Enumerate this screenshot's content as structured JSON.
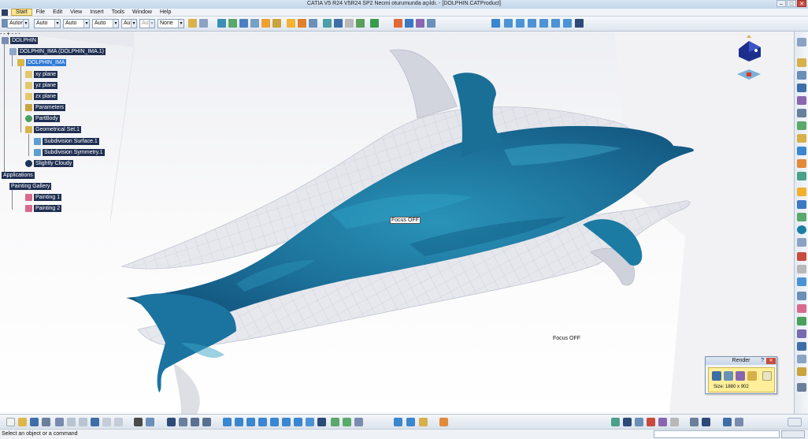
{
  "window": {
    "title": "CATIA V5 R24 V5R24 SP2 Necmi oturumunda açıldı. - [DOLPHIN.CATProduct]",
    "min_label": "–",
    "max_label": "□",
    "close_label": "✕"
  },
  "menu": {
    "items": [
      "Start",
      "File",
      "Edit",
      "View",
      "Insert",
      "Tools",
      "Window",
      "Help"
    ]
  },
  "toolbar": {
    "combos": [
      "Autom.",
      "Auto",
      "Auto",
      "Auto",
      "Aut",
      "Aut",
      "None"
    ]
  },
  "tree": {
    "root": "DOLPHIN",
    "instance": "DOLPHIN_IMA (DOLPHIN_IMA.1)",
    "part": "DOLPHIN_IMA",
    "xy_plane": "xy plane",
    "yz_plane": "yz plane",
    "zx_plane": "zx plane",
    "parameters": "Parameters",
    "partbody": "PartBody",
    "geoset": "Geometrical Set.1",
    "subdiv_surface": "Subdivision Surface.1",
    "subdiv_symmetry": "Subdivision Symmetry.1",
    "environment": "Slightly Cloudy",
    "applications": "Applications",
    "painting_gallery": "Painting Gallery",
    "painting1": "Painting 1",
    "painting2": "Painting 2"
  },
  "viewport": {
    "focus_label_1": "Focus OFF",
    "focus_label_2": "Focus OFF"
  },
  "render_panel": {
    "title": "Render",
    "help": "?",
    "close": "✕",
    "size": "Size: 1880 x 902"
  },
  "status": {
    "message": "Select an object or a command"
  },
  "colors": {
    "dolphin": "#1e7fa3",
    "shadow": "#c9ccd6",
    "tree_label_bg": "#1f2f52",
    "selected_bg": "#2f7bd6"
  }
}
